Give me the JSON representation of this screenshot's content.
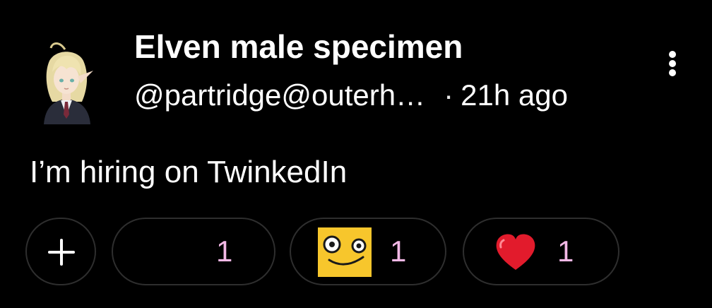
{
  "post": {
    "author": {
      "display_name": "Elven male specimen",
      "handle": "@partridge@outerh…",
      "avatar_icon": "elf-avatar-icon"
    },
    "separator": "·",
    "timestamp": "21h ago",
    "body": "I’m hiring on TwinkedIn",
    "menu_icon": "more-vertical-icon",
    "reactions": [
      {
        "name": "custom-emoji",
        "count": "1"
      },
      {
        "name": "face-emoji",
        "count": "1"
      },
      {
        "name": "red-heart-emoji",
        "count": "1"
      }
    ],
    "add_reaction_icon": "plus-icon"
  },
  "colors": {
    "background": "#000000",
    "text": "#ffffff",
    "reaction_count": "#f3b8e6",
    "pill_border": "#2e2e2e",
    "face_emoji_yellow": "#f7c62c",
    "heart_red": "#e21b2c"
  }
}
